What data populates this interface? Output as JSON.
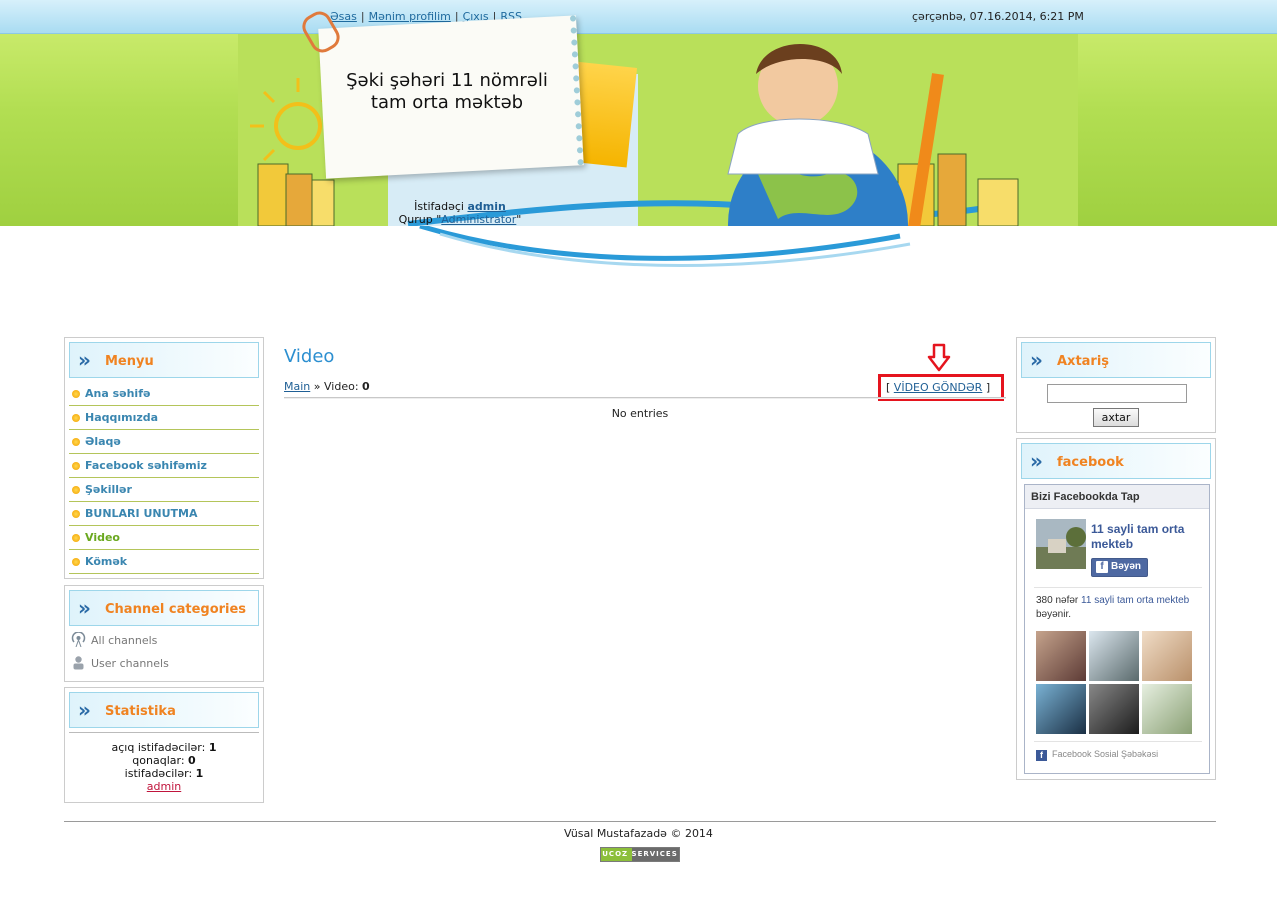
{
  "topbar": {
    "links": [
      "Əsas",
      "Mənim profilim",
      "Çıxış",
      "RSS"
    ],
    "separator": "|",
    "datetime": "çərçənbə, 07.16.2014, 6:21 PM"
  },
  "header": {
    "site_title_line1": "Şəki şəhəri 11 nömrəli",
    "site_title_line2": "tam orta məktəb",
    "user_prefix": "İstifadəçi",
    "username": "admin",
    "group_prefix": "Qurup \"",
    "group_name": "Administrator",
    "group_suffix": "\""
  },
  "left": {
    "menu": {
      "title": "Menyu",
      "items": [
        {
          "label": "Ana səhifə",
          "active": false
        },
        {
          "label": "Haqqımızda",
          "active": false
        },
        {
          "label": "Əlaqə",
          "active": false
        },
        {
          "label": "Facebook səhifəmiz",
          "active": false
        },
        {
          "label": "Şəkillər",
          "active": false
        },
        {
          "label": "BUNLARI UNUTMA",
          "active": false
        },
        {
          "label": "Video",
          "active": true
        },
        {
          "label": "Kömək",
          "active": false
        }
      ]
    },
    "channels": {
      "title": "Channel categories",
      "items": [
        {
          "label": "All channels",
          "icon": "broadcast-icon"
        },
        {
          "label": "User channels",
          "icon": "user-icon"
        }
      ]
    },
    "stats": {
      "title": "Statistika",
      "online_label": "açıq istifadəcilər:",
      "online_value": "1",
      "guests_label": "qonaqlar:",
      "guests_value": "0",
      "users_label": "istifadəcilər:",
      "users_value": "1",
      "user_link": "admin"
    }
  },
  "main": {
    "title": "Video",
    "breadcrumb_home": "Main",
    "breadcrumb_sep": "»",
    "breadcrumb_current": "Video:",
    "count": "0",
    "send_open": "[",
    "send_label": "VİDEO GÖNDƏR",
    "send_close": "]",
    "empty_text": "No entries"
  },
  "right": {
    "search": {
      "title": "Axtariş",
      "input_value": "",
      "button_label": "axtar"
    },
    "facebook": {
      "title": "facebook",
      "widget_header": "Bizi Facebookda Tap",
      "page_name": "11 sayli tam orta mekteb",
      "like_label": "Bəyən",
      "likes_prefix": "380 nəfər",
      "likes_page": "11 sayli tam orta mekteb",
      "likes_suffix": "bəyənir.",
      "footer": "Facebook Sosial Şəbəkəsi"
    }
  },
  "footer": {
    "copyright": "Vüsal Mustafazadə © 2014",
    "badge": "UCOZ SERVICES"
  },
  "colors": {
    "accent_orange": "#f08321",
    "link_blue": "#1f5f95",
    "title_blue": "#2c8fd0",
    "highlight_red": "#e5141e",
    "facebook_blue": "#3b5998"
  }
}
